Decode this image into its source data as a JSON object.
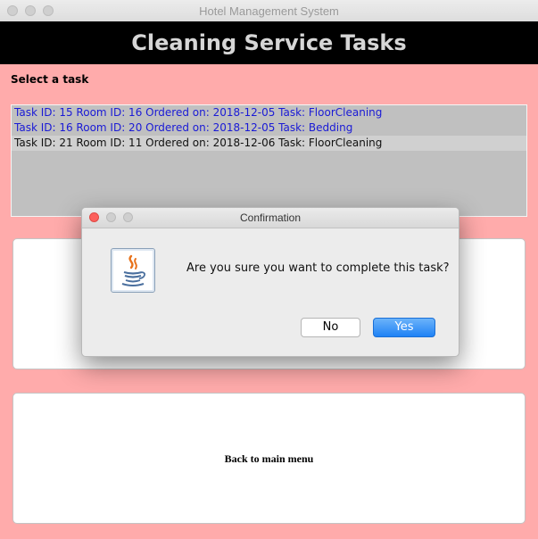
{
  "window": {
    "title": "Hotel Management System"
  },
  "header": {
    "title": "Cleaning Service Tasks"
  },
  "select_label": "Select a task",
  "tasks": [
    "Task ID: 15  Room ID: 16  Ordered on: 2018-12-05  Task: FloorCleaning",
    "Task ID: 16  Room ID: 20  Ordered on: 2018-12-05  Task: Bedding",
    "Task ID: 21  Room ID: 11  Ordered on: 2018-12-06  Task: FloorCleaning"
  ],
  "back_button_label": "Back to main menu",
  "dialog": {
    "title": "Confirmation",
    "message": "Are you sure you want to complete this task?",
    "no_label": "No",
    "yes_label": "Yes"
  },
  "colors": {
    "background": "#ffabab",
    "header_bg": "#000000",
    "task_text": "#1a1ad6",
    "accent": "#1f82f5"
  }
}
